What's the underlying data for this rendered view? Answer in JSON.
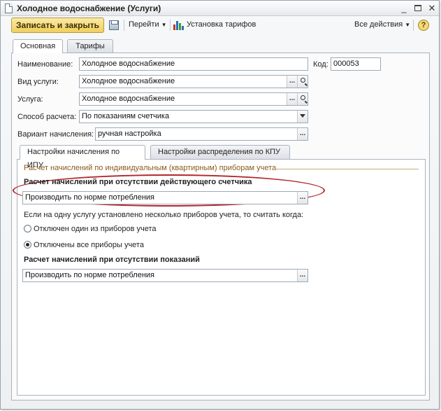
{
  "window": {
    "title": "Холодное водоснабжение (Услуги)",
    "minimize_glyph": "_",
    "close_glyph": "✕"
  },
  "toolbar": {
    "save_close_label": "Записать и закрыть",
    "goto_label": "Перейти",
    "tariffs_label": "Установка тарифов",
    "all_actions_label": "Все действия",
    "help_label": "?"
  },
  "tabs": [
    {
      "label": "Основная",
      "active": true
    },
    {
      "label": "Тарифы",
      "active": false
    }
  ],
  "form": {
    "name_label": "Наименование:",
    "name_value": "Холодное водоснабжение",
    "code_label": "Код:",
    "code_value": "000053",
    "service_type_label": "Вид услуги:",
    "service_type_value": "Холодное водоснабжение",
    "service_label": "Услуга:",
    "service_value": "Холодное водоснабжение",
    "calc_method_label": "Способ расчета:",
    "calc_method_value": "По показаниям счетчика",
    "accrual_variant_label": "Вариант начисления:",
    "accrual_variant_value": "ручная настройка"
  },
  "inner_tabs": [
    {
      "label": "Настройки начисления по ИПУ",
      "active": true
    },
    {
      "label": "Настройки распределения по КПУ",
      "active": false
    }
  ],
  "ipu": {
    "group_title": "Расчет начислений по индивидуальным (квартирным) приборам учета",
    "no_meter_heading": "Расчет начислений при отсутствии действующего счетчика",
    "no_meter_value": "Производить по норме потребления",
    "multi_meter_question": "Если на одну услугу установлено несколько приборов учета, то считать когда:",
    "radio_options": [
      {
        "label": "Отключен один из приборов учета",
        "checked": false
      },
      {
        "label": "Отключены все приборы учета",
        "checked": true
      }
    ],
    "no_readings_heading": "Расчет начислений при отсутствии показаний",
    "no_readings_value": "Производить по норме потребления"
  },
  "colors": {
    "primary_button": "#f1cf5e",
    "highlight_ellipse": "#b3262a",
    "group_title": "#8a5a1a"
  },
  "icons": [
    "document-icon",
    "save-icon",
    "chart-icon",
    "help-icon",
    "search-icon",
    "dropdown-arrow-icon",
    "ellipsis-icon"
  ]
}
